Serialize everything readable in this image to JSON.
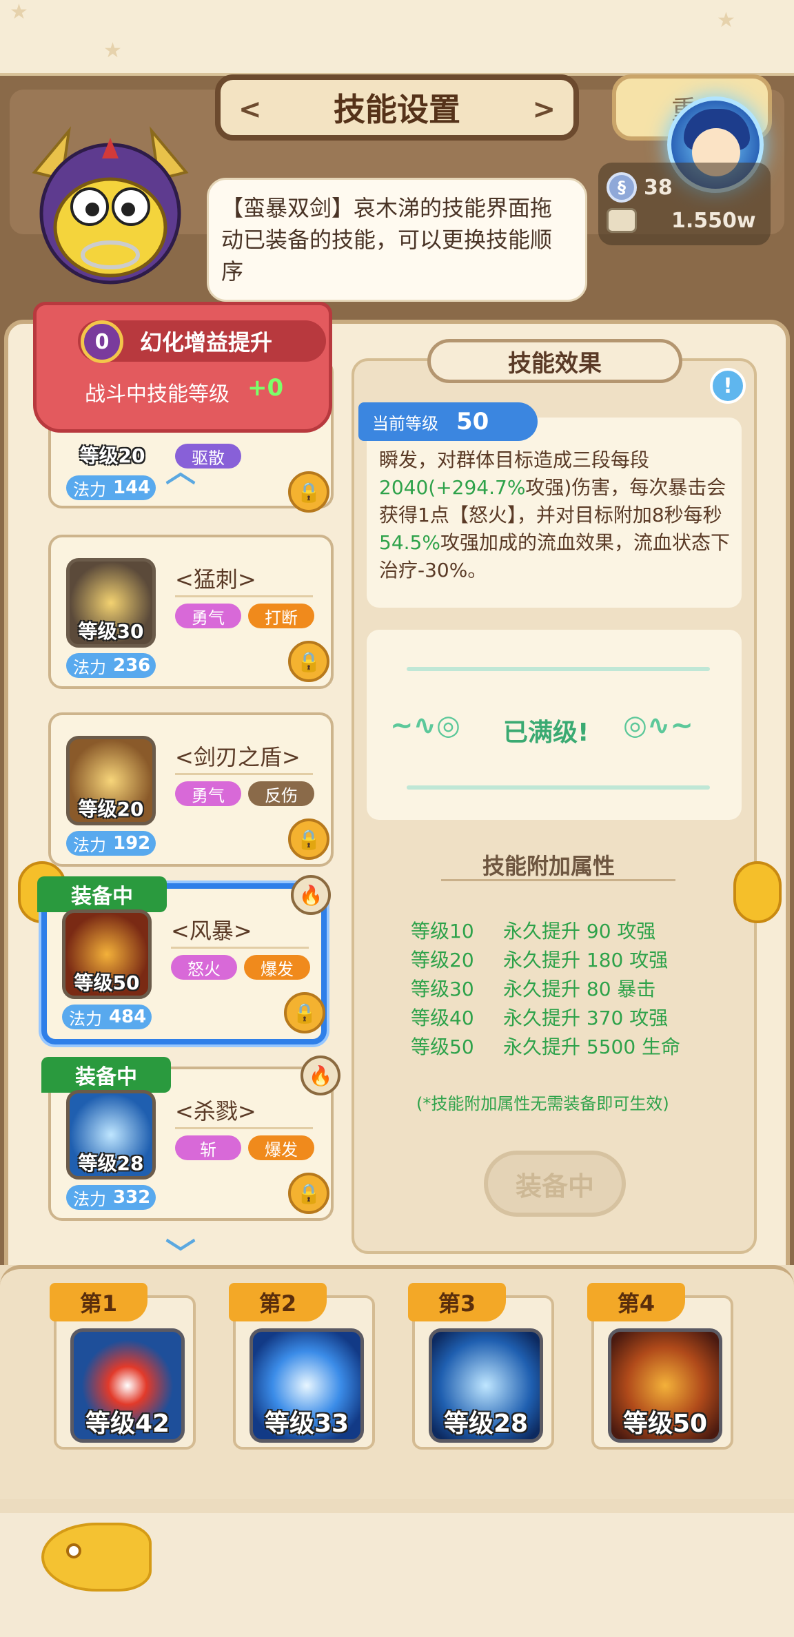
{
  "header": {
    "title": "技能设置",
    "reset_label": "重",
    "currency": [
      {
        "icon": "swirl-coin-icon",
        "value": "38"
      },
      {
        "icon": "scroll-icon",
        "value": "1.550w"
      }
    ]
  },
  "speech": {
    "text": "【蛮暴双剑】哀木涕的技能界面拖动已装备的技能，可以更换技能顺序"
  },
  "boost": {
    "badge": "0",
    "title": "幻化增益提升",
    "subtitle": "战斗中技能等级",
    "value": "+0"
  },
  "skills": [
    {
      "name": "",
      "level": "等级20",
      "mana_label": "法力",
      "mana": "144",
      "tags": [
        "驱散"
      ],
      "equipped": false
    },
    {
      "name": "<猛刺>",
      "level": "等级30",
      "mana_label": "法力",
      "mana": "236",
      "tags": [
        "勇气",
        "打断"
      ],
      "equipped": false
    },
    {
      "name": "<剑刃之盾>",
      "level": "等级20",
      "mana_label": "法力",
      "mana": "192",
      "tags": [
        "勇气",
        "反伤"
      ],
      "equipped": false
    },
    {
      "name": "<风暴>",
      "level": "等级50",
      "mana_label": "法力",
      "mana": "484",
      "tags": [
        "怒火",
        "爆发"
      ],
      "equipped": true
    },
    {
      "name": "<杀戮>",
      "level": "等级28",
      "mana_label": "法力",
      "mana": "332",
      "tags": [
        "斩",
        "爆发"
      ],
      "equipped": true
    }
  ],
  "equipped_label": "装备中",
  "effect": {
    "title": "技能效果",
    "current_level_label": "当前等级",
    "current_level": "50",
    "desc_1": "瞬发，对群体目标造成三段每段",
    "desc_v1": "2040",
    "desc_2": "(+",
    "desc_v2": "294.7%",
    "desc_3": "攻强)伤害，每次暴击会获得1点【怒火】，并对目标附加8秒每秒",
    "desc_v3": "54.5%",
    "desc_4": "攻强加成的流血效果，流血状态下治疗-30%。",
    "maxed": "已满级!",
    "attr_title": "技能附加属性",
    "attrs": [
      {
        "level": "等级10",
        "text": "永久提升 90 攻强"
      },
      {
        "level": "等级20",
        "text": "永久提升 180 攻强"
      },
      {
        "level": "等级30",
        "text": "永久提升 80 暴击"
      },
      {
        "level": "等级40",
        "text": "永久提升 370 攻强"
      },
      {
        "level": "等级50",
        "text": "永久提升 5500 生命"
      }
    ],
    "note": "(*技能附加属性无需装备即可生效)",
    "equip_button": "装备中"
  },
  "slots": [
    {
      "label": "第1",
      "level": "等级42"
    },
    {
      "label": "第2",
      "level": "等级33"
    },
    {
      "label": "第3",
      "level": "等级28"
    },
    {
      "label": "第4",
      "level": "等级50"
    }
  ],
  "colors": {
    "equipped_green": "#2a9a3e",
    "active_border": "#2f7fe8",
    "effect_green": "#2ea24a",
    "tag_purple": "#d869d8",
    "tag_orange": "#f08a1c",
    "tag_brown": "#8a6a49"
  }
}
